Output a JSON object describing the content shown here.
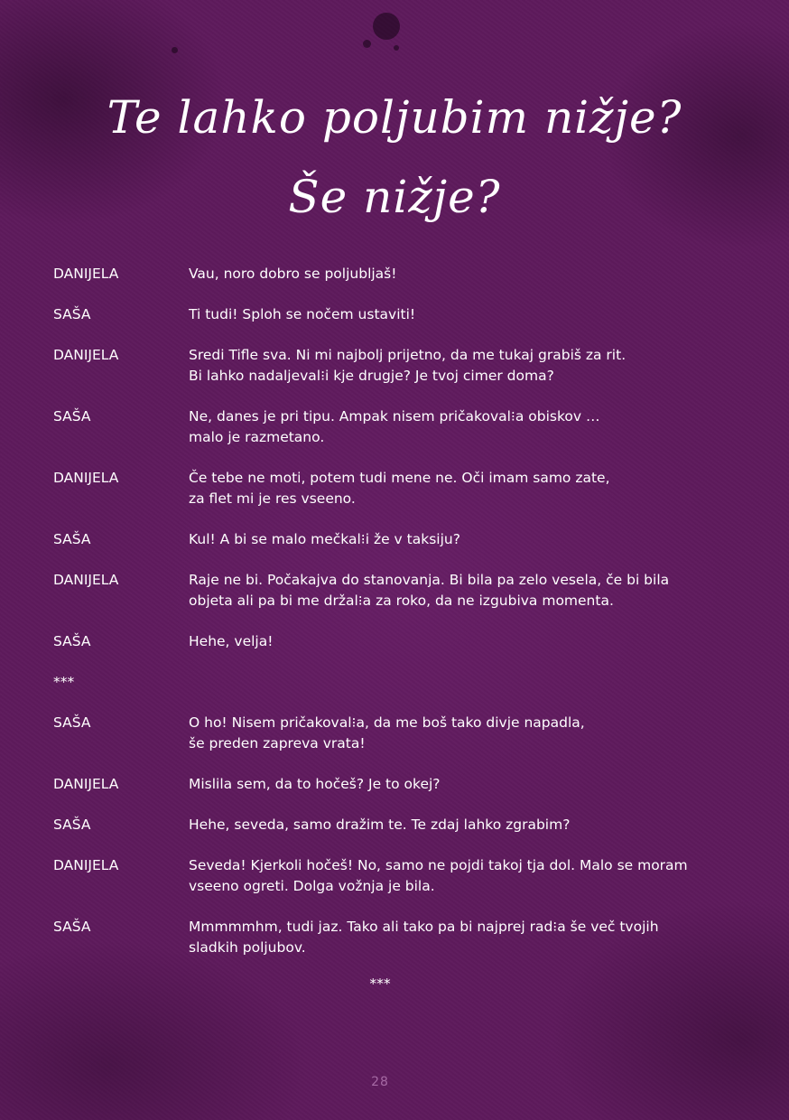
{
  "title_lines": [
    "Te lahko poljubim nižje?",
    "Še nižje?"
  ],
  "dialogue": [
    {
      "speaker": "DANIJELA",
      "text": "Vau, noro dobro se poljubljaš!"
    },
    {
      "speaker": "SAŠA",
      "text": "Ti tudi! Sploh se nočem ustaviti!"
    },
    {
      "speaker": "DANIJELA",
      "text": "Sredi Tifle sva. Ni mi najbolj prijetno, da me tukaj grabiš za rit.\nBi lahko nadaljeval⁝i kje drugje? Je tvoj cimer doma?"
    },
    {
      "speaker": "SAŠA",
      "text": "Ne, danes je pri tipu. Ampak nisem pričakoval⁝a obiskov …\nmalo je razmetano."
    },
    {
      "speaker": "DANIJELA",
      "text": "Če tebe ne moti, potem tudi mene ne. Oči imam samo zate,\nza flet mi je res vseeno."
    },
    {
      "speaker": "SAŠA",
      "text": "Kul! A bi se malo mečkal⁝i že v taksiju?"
    },
    {
      "speaker": "DANIJELA",
      "text": "Raje ne bi. Počakajva do stanovanja. Bi bila pa zelo vesela, če bi bila\nobjeta ali pa bi me držal⁝a za roko, da ne izgubiva momenta."
    },
    {
      "speaker": "SAŠA",
      "text": "Hehe, velja!"
    }
  ],
  "scene_break": "***",
  "dialogue2": [
    {
      "speaker": "SAŠA",
      "text": "O ho! Nisem pričakoval⁝a, da me boš tako divje napadla,\nše preden zapreva vrata!"
    },
    {
      "speaker": "DANIJELA",
      "text": "Mislila sem, da to hočeš? Je to okej?"
    },
    {
      "speaker": "SAŠA",
      "text": "Hehe, seveda, samo dražim te. Te zdaj lahko zgrabim?"
    },
    {
      "speaker": "DANIJELA",
      "text": "Seveda! Kjerkoli hočeš! No, samo ne pojdi takoj tja dol. Malo se moram\nvseeno ogreti. Dolga vožnja je bila."
    },
    {
      "speaker": "SAŠA",
      "text": "Mmmmmhm, tudi jaz. Tako ali tako pa bi najprej rad⁝a še več tvojih\nsladkih poljubov."
    }
  ],
  "end_break": "***",
  "page_number": "28"
}
